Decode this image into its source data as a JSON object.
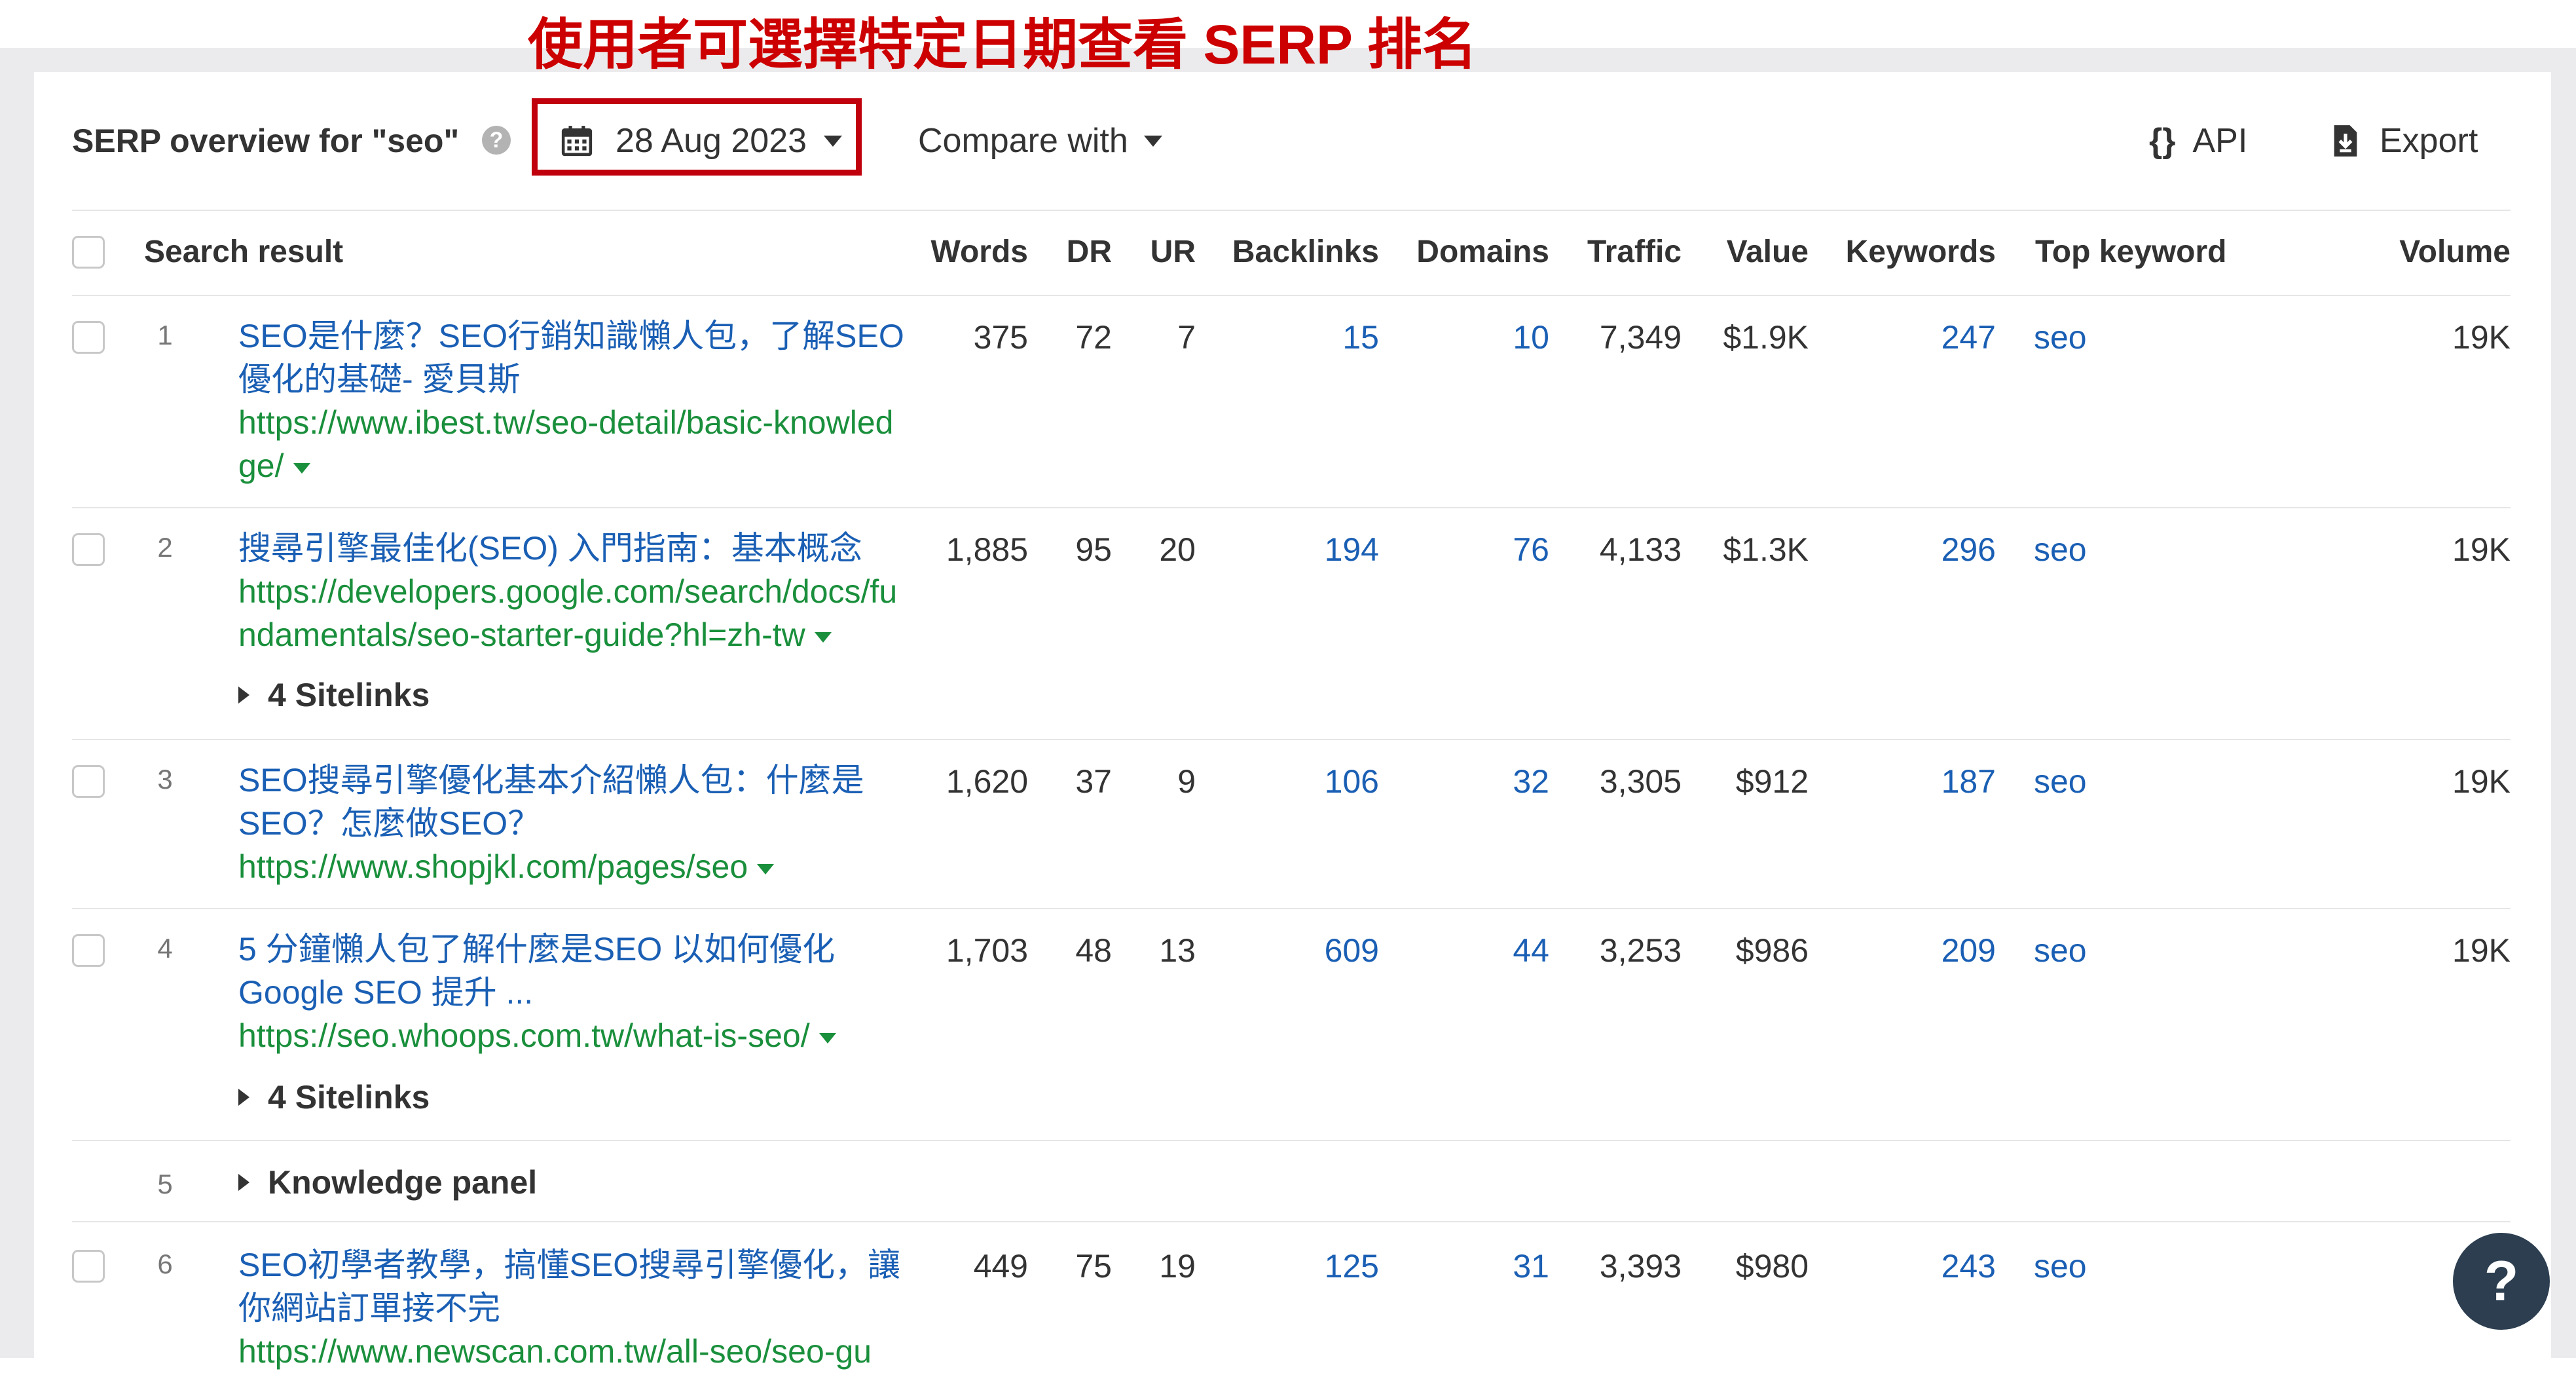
{
  "annotation": "使用者可選擇特定日期查看 SERP 排名",
  "header": {
    "title": "SERP overview for \"seo\"",
    "help": "?",
    "date": "28 Aug 2023",
    "compare": "Compare with",
    "api_braces": "{}",
    "api": "API",
    "export": "Export"
  },
  "columns": {
    "search_result": "Search result",
    "words": "Words",
    "dr": "DR",
    "ur": "UR",
    "backlinks": "Backlinks",
    "domains": "Domains",
    "traffic": "Traffic",
    "value": "Value",
    "keywords": "Keywords",
    "top_keyword": "Top keyword",
    "volume": "Volume"
  },
  "rows": [
    {
      "rank": "1",
      "title": "SEO是什麼？SEO行銷知識懶人包，了解SEO優化的基礎- 愛貝斯",
      "url": "https://www.ibest.tw/seo-detail/basic-knowledge/",
      "words": "375",
      "dr": "72",
      "ur": "7",
      "backlinks": "15",
      "domains": "10",
      "traffic": "7,349",
      "value": "$1.9K",
      "keywords": "247",
      "top_keyword": "seo",
      "volume": "19K"
    },
    {
      "rank": "2",
      "title": "搜尋引擎最佳化(SEO) 入門指南：基本概念",
      "url": "https://developers.google.com/search/docs/fundamentals/seo-starter-guide?hl=zh-tw",
      "words": "1,885",
      "dr": "95",
      "ur": "20",
      "backlinks": "194",
      "domains": "76",
      "traffic": "4,133",
      "value": "$1.3K",
      "keywords": "296",
      "top_keyword": "seo",
      "volume": "19K",
      "sitelinks": "4 Sitelinks"
    },
    {
      "rank": "3",
      "title": "SEO搜尋引擎優化基本介紹懶人包：什麼是SEO？怎麼做SEO？",
      "url": "https://www.shopjkl.com/pages/seo",
      "words": "1,620",
      "dr": "37",
      "ur": "9",
      "backlinks": "106",
      "domains": "32",
      "traffic": "3,305",
      "value": "$912",
      "keywords": "187",
      "top_keyword": "seo",
      "volume": "19K"
    },
    {
      "rank": "4",
      "title": "5 分鐘懶人包了解什麼是SEO 以如何優化Google SEO 提升 ...",
      "url": "https://seo.whoops.com.tw/what-is-seo/",
      "words": "1,703",
      "dr": "48",
      "ur": "13",
      "backlinks": "609",
      "domains": "44",
      "traffic": "3,253",
      "value": "$986",
      "keywords": "209",
      "top_keyword": "seo",
      "volume": "19K",
      "sitelinks": "4 Sitelinks"
    },
    {
      "rank": "5",
      "panel": "Knowledge panel"
    },
    {
      "rank": "6",
      "title": "SEO初學者教學，搞懂SEO搜尋引擎優化，讓你網站訂單接不完",
      "url": "https://www.newscan.com.tw/all-seo/seo-gu",
      "words": "449",
      "dr": "75",
      "ur": "19",
      "backlinks": "125",
      "domains": "31",
      "traffic": "3,393",
      "value": "$980",
      "keywords": "243",
      "top_keyword": "seo",
      "volume": ""
    }
  ],
  "fab": "?"
}
